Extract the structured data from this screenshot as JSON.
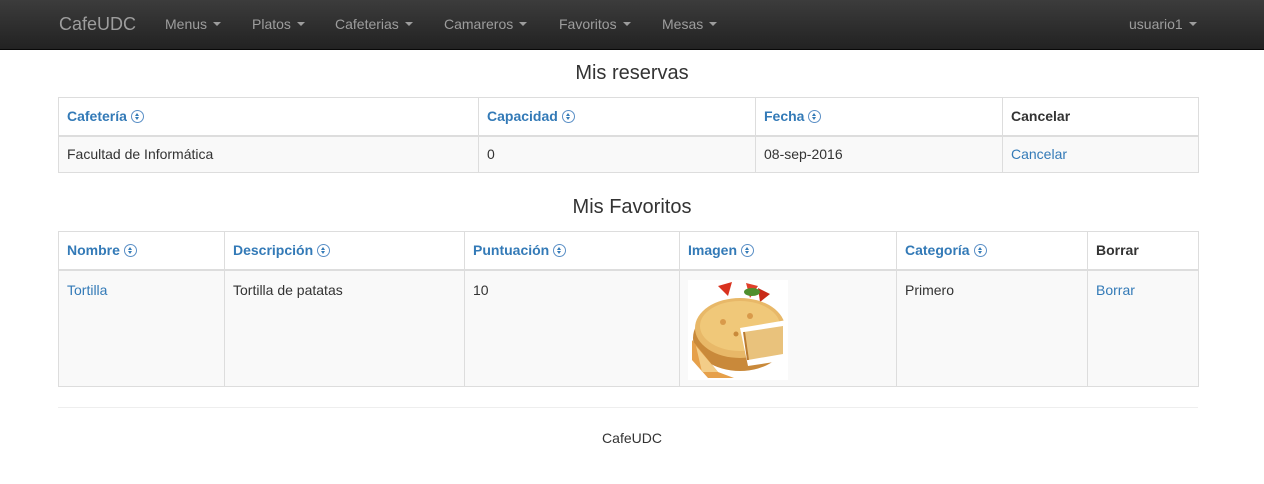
{
  "navbar": {
    "brand": "CafeUDC",
    "items": [
      {
        "label": "Menus"
      },
      {
        "label": "Platos"
      },
      {
        "label": "Cafeterias"
      },
      {
        "label": "Camareros"
      },
      {
        "label": "Favoritos"
      },
      {
        "label": "Mesas"
      }
    ],
    "user": "usuario1"
  },
  "reservas": {
    "title": "Mis reservas",
    "columns": [
      "Cafetería",
      "Capacidad",
      "Fecha",
      "Cancelar"
    ],
    "rows": [
      {
        "cafeteria": "Facultad de Informática",
        "capacidad": "0",
        "fecha": "08-sep-2016",
        "cancelar": "Cancelar"
      }
    ]
  },
  "favoritos": {
    "title": "Mis Favoritos",
    "columns": [
      "Nombre",
      "Descripción",
      "Puntuación",
      "Imagen",
      "Categoría",
      "Borrar"
    ],
    "rows": [
      {
        "nombre": "Tortilla",
        "descripcion": "Tortilla de patatas",
        "puntuacion": "10",
        "imagen": "tortilla-photo",
        "categoria": "Primero",
        "borrar": "Borrar"
      }
    ]
  },
  "footer": {
    "text": "CafeUDC"
  },
  "icons": {
    "sort": "sort-icon",
    "caret": "caret-down-icon"
  },
  "colors": {
    "link": "#337ab7",
    "navbar": "#222222",
    "nav_text": "#9d9d9d"
  }
}
